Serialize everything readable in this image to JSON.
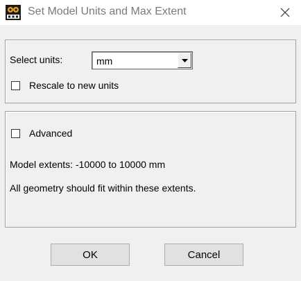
{
  "window": {
    "title": "Set Model Units and Max Extent",
    "app_icon": "edt-logo-icon",
    "close_icon": "close-icon"
  },
  "units": {
    "label": "Select units:",
    "selected": "mm",
    "rescale_label": "Rescale to new units",
    "rescale_checked": false
  },
  "advanced": {
    "label": "Advanced",
    "checked": false,
    "extents_text": "Model extents: -10000 to 10000 mm",
    "note_text": "All geometry should fit within these extents."
  },
  "buttons": {
    "ok_label": "OK",
    "cancel_label": "Cancel"
  },
  "colors": {
    "title_text": "#7a7a7a",
    "icon_orange": "#e8a020"
  }
}
